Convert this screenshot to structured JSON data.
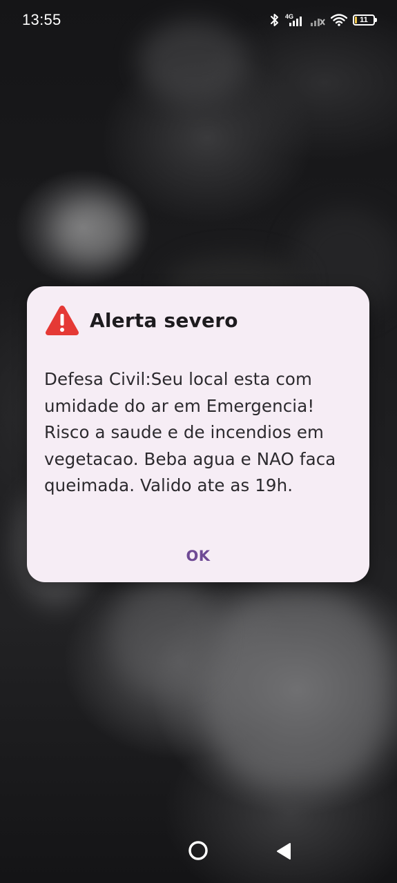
{
  "status_bar": {
    "time": "13:55",
    "network_label": "4G",
    "battery_level": "11",
    "battery_fraction": 0.11
  },
  "dialog": {
    "icon": "warning-triangle-icon",
    "icon_color": "#e53935",
    "title": "Alerta severo",
    "message": "Defesa Civil:Seu local esta com umidade do ar em Emergencia! Risco a saude e de incendios em vegetacao. Beba agua e NAO faca queimada. Valido ate as 19h.",
    "ok_label": "OK",
    "accent_color": "#6f4a95",
    "background_color": "#f6edf5"
  },
  "navigation_bar": {
    "home_icon": "home-circle-icon",
    "back_icon": "back-triangle-icon"
  }
}
